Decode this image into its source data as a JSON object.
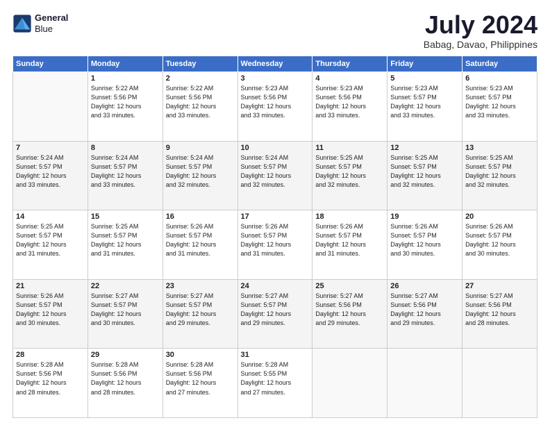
{
  "logo": {
    "line1": "General",
    "line2": "Blue"
  },
  "title": "July 2024",
  "location": "Babag, Davao, Philippines",
  "headers": [
    "Sunday",
    "Monday",
    "Tuesday",
    "Wednesday",
    "Thursday",
    "Friday",
    "Saturday"
  ],
  "weeks": [
    [
      {
        "day": "",
        "info": ""
      },
      {
        "day": "1",
        "info": "Sunrise: 5:22 AM\nSunset: 5:56 PM\nDaylight: 12 hours\nand 33 minutes."
      },
      {
        "day": "2",
        "info": "Sunrise: 5:22 AM\nSunset: 5:56 PM\nDaylight: 12 hours\nand 33 minutes."
      },
      {
        "day": "3",
        "info": "Sunrise: 5:23 AM\nSunset: 5:56 PM\nDaylight: 12 hours\nand 33 minutes."
      },
      {
        "day": "4",
        "info": "Sunrise: 5:23 AM\nSunset: 5:56 PM\nDaylight: 12 hours\nand 33 minutes."
      },
      {
        "day": "5",
        "info": "Sunrise: 5:23 AM\nSunset: 5:57 PM\nDaylight: 12 hours\nand 33 minutes."
      },
      {
        "day": "6",
        "info": "Sunrise: 5:23 AM\nSunset: 5:57 PM\nDaylight: 12 hours\nand 33 minutes."
      }
    ],
    [
      {
        "day": "7",
        "info": "Sunrise: 5:24 AM\nSunset: 5:57 PM\nDaylight: 12 hours\nand 33 minutes."
      },
      {
        "day": "8",
        "info": "Sunrise: 5:24 AM\nSunset: 5:57 PM\nDaylight: 12 hours\nand 33 minutes."
      },
      {
        "day": "9",
        "info": "Sunrise: 5:24 AM\nSunset: 5:57 PM\nDaylight: 12 hours\nand 32 minutes."
      },
      {
        "day": "10",
        "info": "Sunrise: 5:24 AM\nSunset: 5:57 PM\nDaylight: 12 hours\nand 32 minutes."
      },
      {
        "day": "11",
        "info": "Sunrise: 5:25 AM\nSunset: 5:57 PM\nDaylight: 12 hours\nand 32 minutes."
      },
      {
        "day": "12",
        "info": "Sunrise: 5:25 AM\nSunset: 5:57 PM\nDaylight: 12 hours\nand 32 minutes."
      },
      {
        "day": "13",
        "info": "Sunrise: 5:25 AM\nSunset: 5:57 PM\nDaylight: 12 hours\nand 32 minutes."
      }
    ],
    [
      {
        "day": "14",
        "info": "Sunrise: 5:25 AM\nSunset: 5:57 PM\nDaylight: 12 hours\nand 31 minutes."
      },
      {
        "day": "15",
        "info": "Sunrise: 5:25 AM\nSunset: 5:57 PM\nDaylight: 12 hours\nand 31 minutes."
      },
      {
        "day": "16",
        "info": "Sunrise: 5:26 AM\nSunset: 5:57 PM\nDaylight: 12 hours\nand 31 minutes."
      },
      {
        "day": "17",
        "info": "Sunrise: 5:26 AM\nSunset: 5:57 PM\nDaylight: 12 hours\nand 31 minutes."
      },
      {
        "day": "18",
        "info": "Sunrise: 5:26 AM\nSunset: 5:57 PM\nDaylight: 12 hours\nand 31 minutes."
      },
      {
        "day": "19",
        "info": "Sunrise: 5:26 AM\nSunset: 5:57 PM\nDaylight: 12 hours\nand 30 minutes."
      },
      {
        "day": "20",
        "info": "Sunrise: 5:26 AM\nSunset: 5:57 PM\nDaylight: 12 hours\nand 30 minutes."
      }
    ],
    [
      {
        "day": "21",
        "info": "Sunrise: 5:26 AM\nSunset: 5:57 PM\nDaylight: 12 hours\nand 30 minutes."
      },
      {
        "day": "22",
        "info": "Sunrise: 5:27 AM\nSunset: 5:57 PM\nDaylight: 12 hours\nand 30 minutes."
      },
      {
        "day": "23",
        "info": "Sunrise: 5:27 AM\nSunset: 5:57 PM\nDaylight: 12 hours\nand 29 minutes."
      },
      {
        "day": "24",
        "info": "Sunrise: 5:27 AM\nSunset: 5:57 PM\nDaylight: 12 hours\nand 29 minutes."
      },
      {
        "day": "25",
        "info": "Sunrise: 5:27 AM\nSunset: 5:56 PM\nDaylight: 12 hours\nand 29 minutes."
      },
      {
        "day": "26",
        "info": "Sunrise: 5:27 AM\nSunset: 5:56 PM\nDaylight: 12 hours\nand 29 minutes."
      },
      {
        "day": "27",
        "info": "Sunrise: 5:27 AM\nSunset: 5:56 PM\nDaylight: 12 hours\nand 28 minutes."
      }
    ],
    [
      {
        "day": "28",
        "info": "Sunrise: 5:28 AM\nSunset: 5:56 PM\nDaylight: 12 hours\nand 28 minutes."
      },
      {
        "day": "29",
        "info": "Sunrise: 5:28 AM\nSunset: 5:56 PM\nDaylight: 12 hours\nand 28 minutes."
      },
      {
        "day": "30",
        "info": "Sunrise: 5:28 AM\nSunset: 5:56 PM\nDaylight: 12 hours\nand 27 minutes."
      },
      {
        "day": "31",
        "info": "Sunrise: 5:28 AM\nSunset: 5:55 PM\nDaylight: 12 hours\nand 27 minutes."
      },
      {
        "day": "",
        "info": ""
      },
      {
        "day": "",
        "info": ""
      },
      {
        "day": "",
        "info": ""
      }
    ]
  ]
}
